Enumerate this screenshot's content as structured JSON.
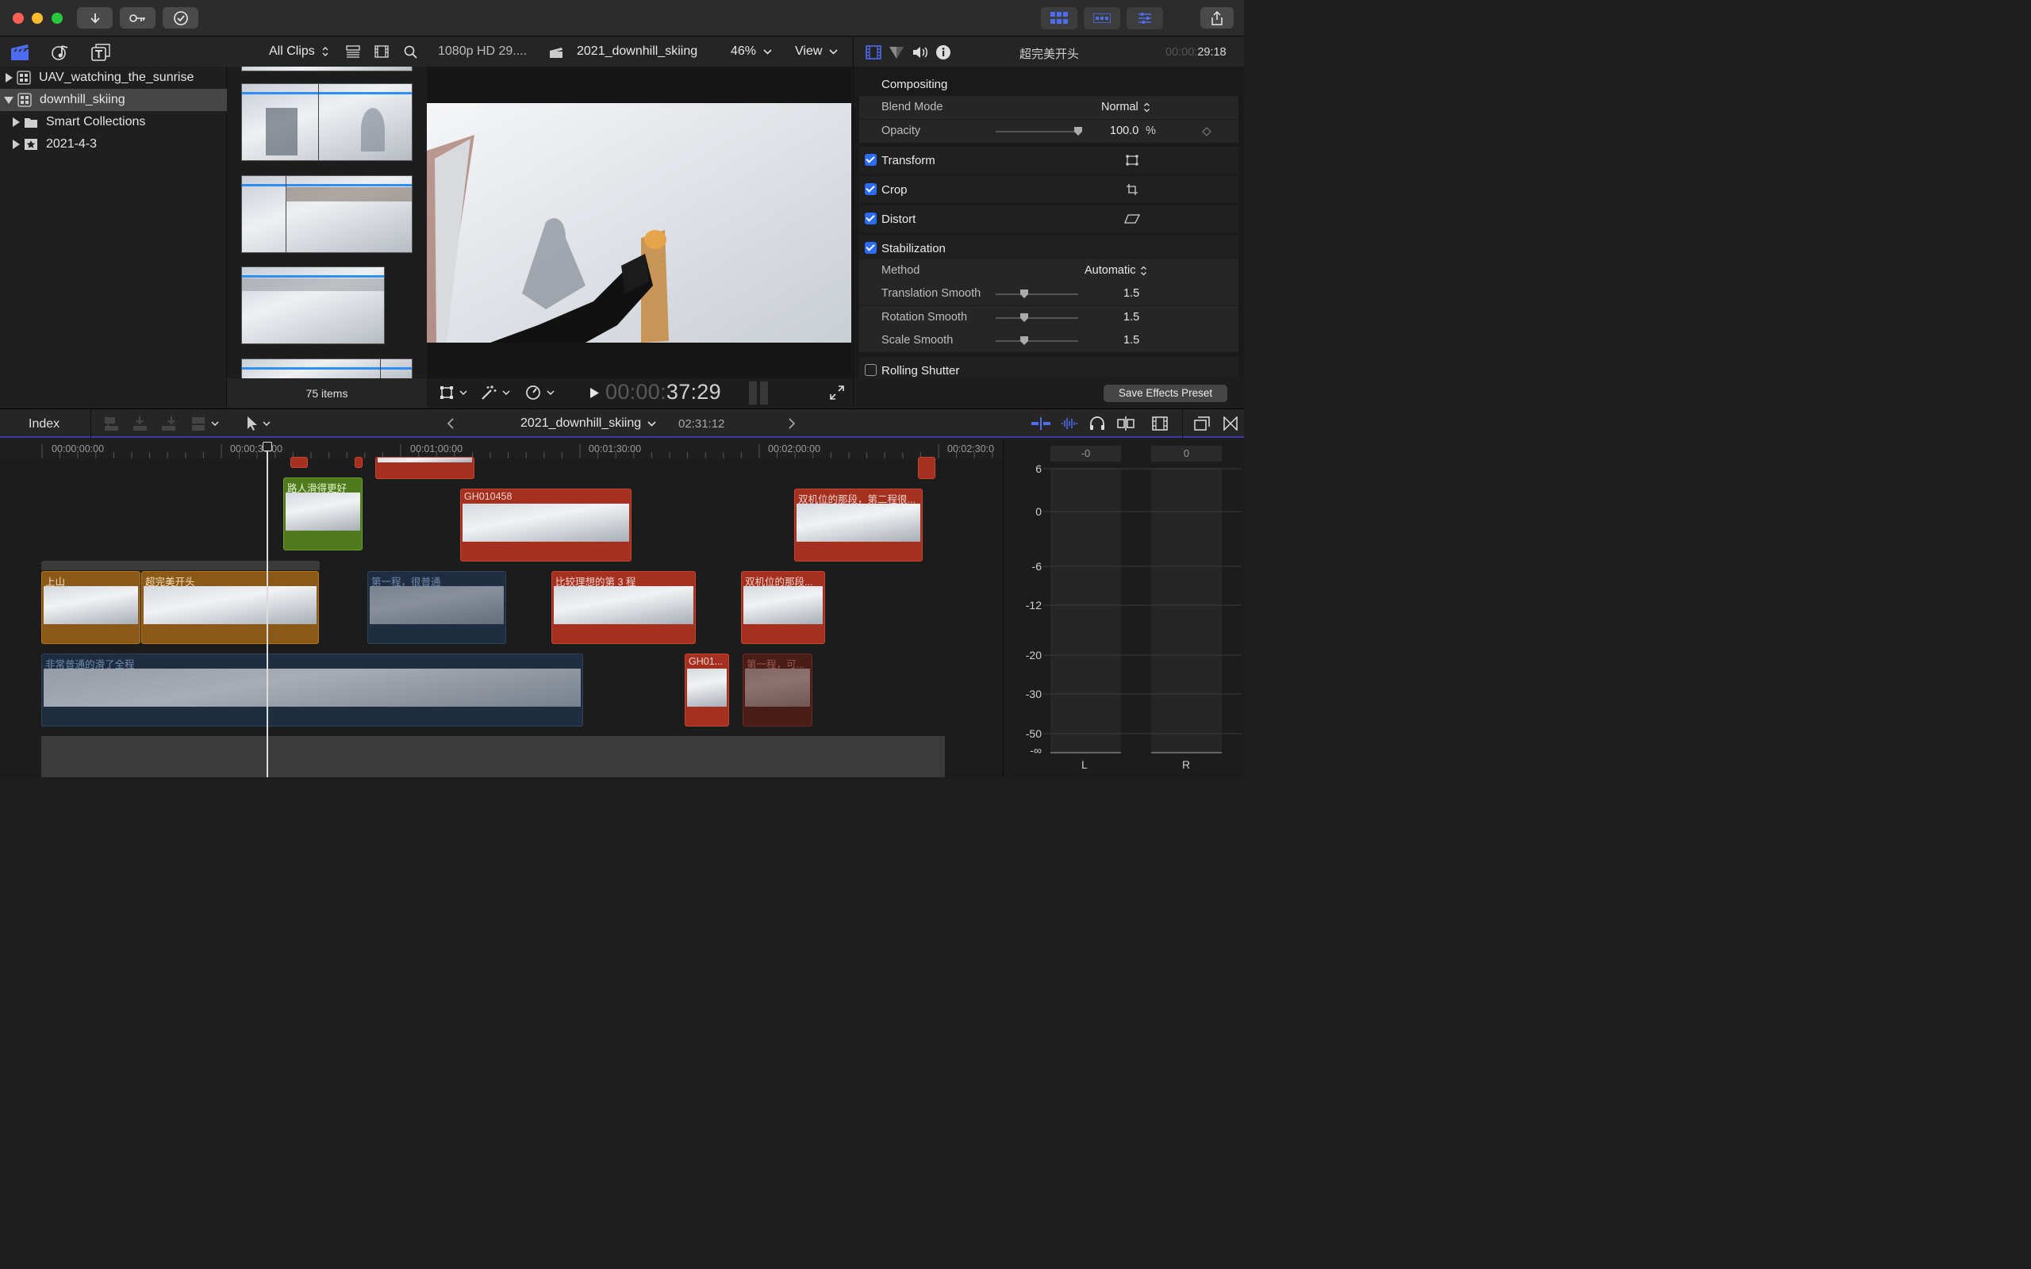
{
  "window": {
    "toolbar_left_icons": [
      "import-arrow-icon",
      "key-icon",
      "checkmark-circle-icon"
    ],
    "toolbar_right_icons": [
      "browser-grid-icon",
      "timeline-icon",
      "inspector-sliders-icon",
      "share-icon"
    ]
  },
  "library": {
    "tabs": [
      "libraries-icon",
      "photos-audio-icon",
      "titles-generators-icon"
    ],
    "items": [
      {
        "label": "UAV_watching_the_sunrise",
        "expanded": false,
        "selected": false
      },
      {
        "label": "downhill_skiing",
        "expanded": true,
        "selected": true
      },
      {
        "label": "Smart Collections",
        "expanded": false,
        "selected": false
      },
      {
        "label": "2021-4-3",
        "expanded": false,
        "selected": false
      }
    ]
  },
  "browser": {
    "filter": "All Clips",
    "footer": "75 items"
  },
  "viewer": {
    "format": "1080p HD 29....",
    "clip_name": "2021_downhill_skiing",
    "zoom": "46%",
    "view_menu": "View",
    "timecode_dim": "00:00:",
    "timecode": "37:29"
  },
  "inspector": {
    "title": "超完美开头",
    "time_dim": "00:00:",
    "time": "29:18",
    "compositing": {
      "heading": "Compositing",
      "blend_mode_label": "Blend Mode",
      "blend_mode_value": "Normal",
      "opacity_label": "Opacity",
      "opacity_value": "100.0",
      "opacity_unit": "%",
      "opacity_fraction": 1.0
    },
    "transform": {
      "label": "Transform",
      "checked": true
    },
    "crop": {
      "label": "Crop",
      "checked": true
    },
    "distort": {
      "label": "Distort",
      "checked": true
    },
    "stabilization": {
      "label": "Stabilization",
      "checked": true,
      "method_label": "Method",
      "method_value": "Automatic",
      "translation_label": "Translation Smooth",
      "translation_value": "1.5",
      "rotation_label": "Rotation Smooth",
      "rotation_value": "1.5",
      "scale_label": "Scale Smooth",
      "scale_value": "1.5"
    },
    "rolling_shutter": {
      "label": "Rolling Shutter",
      "checked": false
    },
    "save_preset": "Save Effects Preset"
  },
  "timeline": {
    "index_label": "Index",
    "project_name": "2021_downhill_skiing",
    "duration": "02:31:12",
    "ruler": [
      "00:00:00:00",
      "00:00:30:00",
      "00:01:00:00",
      "00:01:30:00",
      "00:02:00:00",
      "00:02:30:0"
    ],
    "clips": {
      "green1": "路人滑得更好",
      "red1": "GH010458",
      "red2": "双机位的那段，第二程很...",
      "orange1": "上山",
      "orange2": "超完美开头",
      "blue1": "第一程，很普通",
      "red3": "比较理想的第 3 程",
      "red4": "双机位的那段...",
      "blue2": "非常普通的滑了全程",
      "red5": "GH01...",
      "darkred1": "第一程，可..."
    }
  },
  "audio_meter": {
    "left_peak": "-0",
    "right_peak": "0",
    "scale": [
      "6",
      "0",
      "-6",
      "-12",
      "-20",
      "-30",
      "-50",
      "-∞"
    ],
    "channels": [
      "L",
      "R"
    ]
  },
  "colors": {
    "accent": "#2a6df4",
    "clip_red": "#a6301f",
    "clip_orange": "#8a5817",
    "clip_green": "#4f7a1d",
    "clip_blue": "#1f2d40"
  }
}
